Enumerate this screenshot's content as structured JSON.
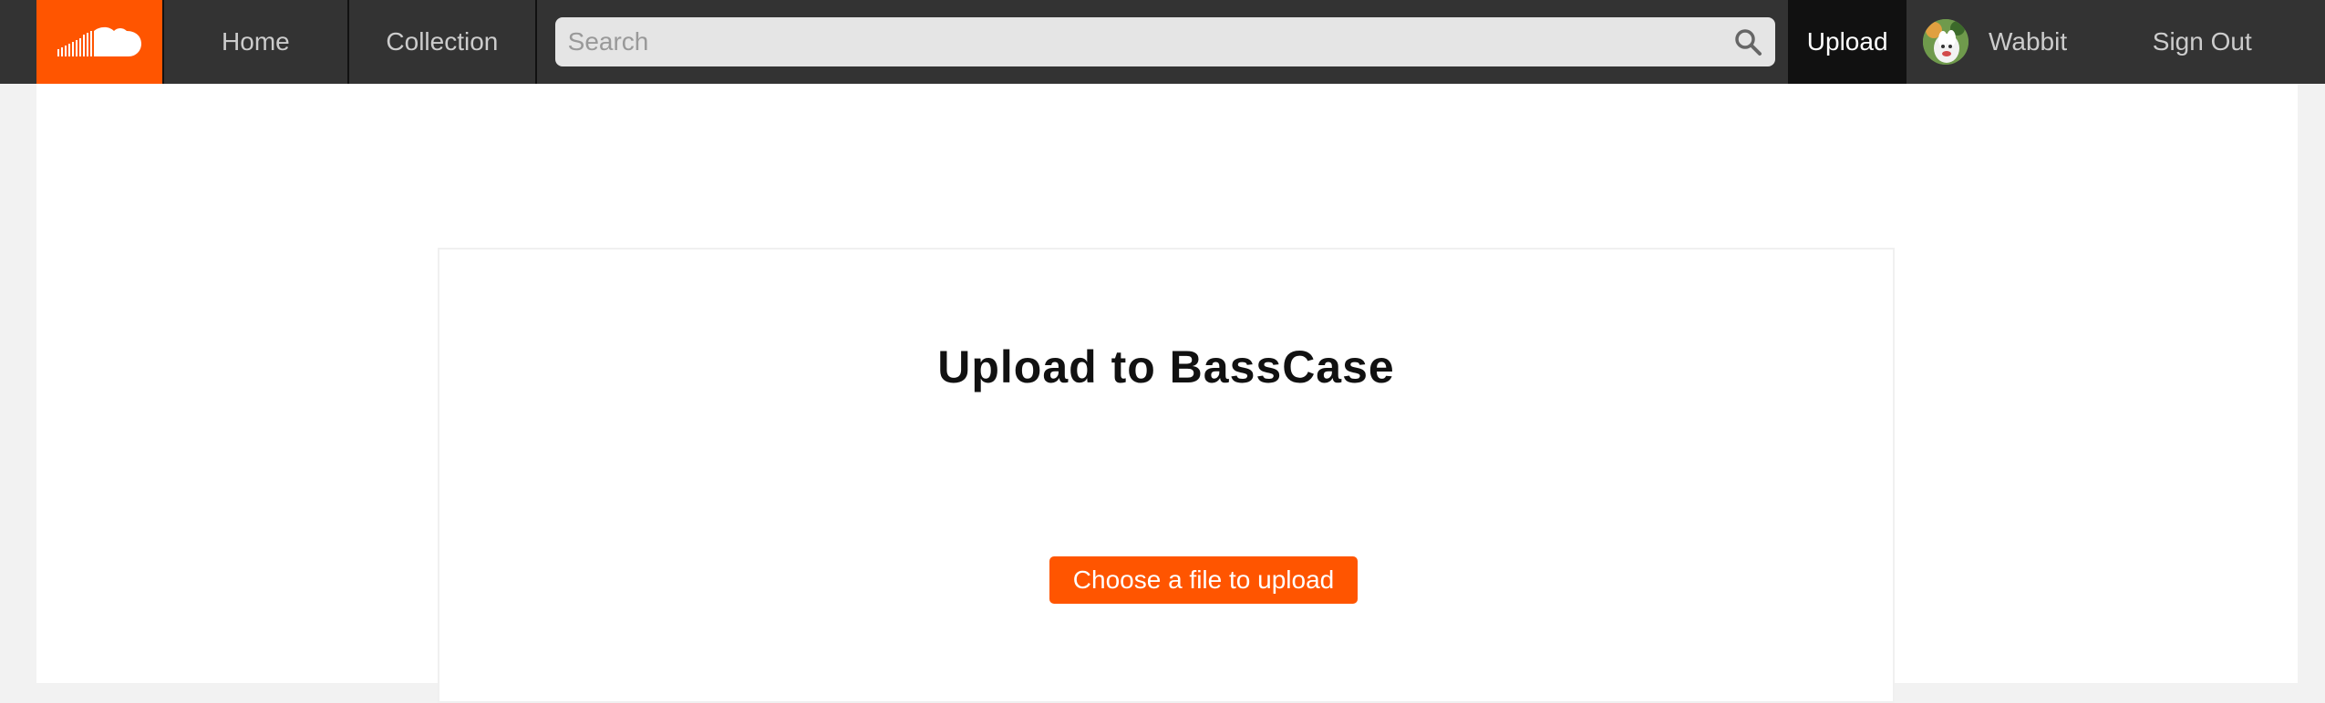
{
  "brand": {
    "logo_icon": "soundcloud-cloud-icon",
    "accent_color": "#ff5500"
  },
  "nav": {
    "home_label": "Home",
    "collection_label": "Collection",
    "upload_label": "Upload",
    "user_name": "Wabbit",
    "sign_out_label": "Sign Out"
  },
  "search": {
    "placeholder": "Search",
    "value": "",
    "icon": "search-icon"
  },
  "main": {
    "title": "Upload to BassCase",
    "choose_file_label": "Choose a file to upload"
  }
}
